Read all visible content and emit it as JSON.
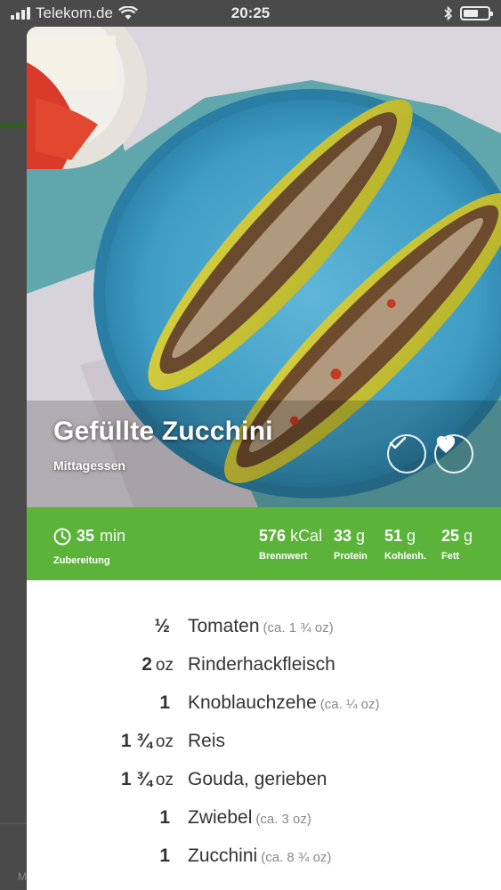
{
  "status_bar": {
    "carrier": "Telekom.de",
    "time": "20:25",
    "battery_level": 0.6
  },
  "recipe": {
    "title": "Gefüllte Zucchini",
    "category": "Mittagessen"
  },
  "nutrition": {
    "prep_time_value": "35",
    "prep_time_unit": "min",
    "prep_time_label": "Zubereitung",
    "calories_value": "576",
    "calories_unit": "kCal",
    "calories_label": "Brennwert",
    "protein_value": "33",
    "protein_unit": "g",
    "protein_label": "Protein",
    "carbs_value": "51",
    "carbs_unit": "g",
    "carbs_label": "Kohlenh.",
    "fat_value": "25",
    "fat_unit": "g",
    "fat_label": "Fett"
  },
  "ingredients": [
    {
      "qty": "½",
      "unit": "",
      "name": "Tomaten",
      "note": "(ca. 1 ¾ oz)"
    },
    {
      "qty": "2",
      "unit": "oz",
      "name": "Rinderhackfleisch",
      "note": ""
    },
    {
      "qty": "1",
      "unit": "",
      "name": "Knoblauchzehe",
      "note": "(ca. ¼ oz)"
    },
    {
      "qty": "1 ¾",
      "unit": "oz",
      "name": "Reis",
      "note": ""
    },
    {
      "qty": "1 ¾",
      "unit": "oz",
      "name": "Gouda, gerieben",
      "note": ""
    },
    {
      "qty": "1",
      "unit": "",
      "name": "Zwiebel",
      "note": "(ca. 3 oz)"
    },
    {
      "qty": "1",
      "unit": "",
      "name": "Zucchini",
      "note": "(ca. 8 ¾ oz)"
    }
  ],
  "colors": {
    "accent_green": "#5bb33a",
    "plate_blue": "#4fa8cf",
    "text_dark": "#333333"
  },
  "icons": {
    "clock": "clock-icon",
    "check": "check-icon",
    "heart": "heart-icon",
    "wifi": "wifi-icon",
    "bluetooth": "bluetooth-icon",
    "battery": "battery-icon",
    "signal": "signal-icon"
  },
  "background": {
    "partial_letter": "M"
  }
}
